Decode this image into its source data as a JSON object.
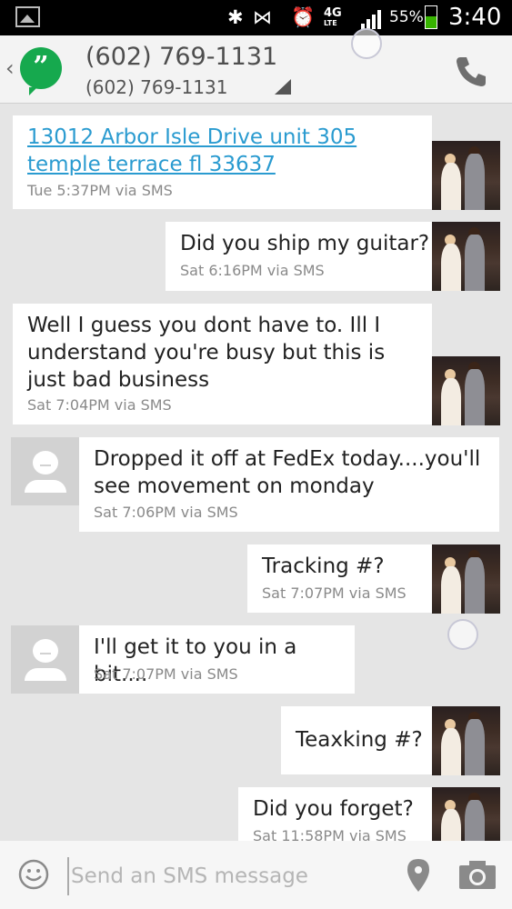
{
  "status_bar": {
    "battery_percent_label": "55%",
    "battery_level": 0.55,
    "network_label": "4G",
    "network_sub": "LTE",
    "time": "3:40",
    "icons": [
      "image-icon",
      "bluetooth-icon",
      "mute-icon",
      "alarm-icon",
      "signal-icon",
      "battery-icon"
    ]
  },
  "header": {
    "title": "(602) 769-1131",
    "subtitle": "(602) 769-1131",
    "app_icon": "hangouts-icon",
    "call_icon": "phone-icon"
  },
  "messages": [
    {
      "side": "outgoing",
      "text": "13012 Arbor Isle Drive unit 305 temple terrace fl 33637",
      "is_link": true,
      "meta": "Tue 5:37PM via SMS"
    },
    {
      "side": "outgoing",
      "text": "Did you ship my guitar?",
      "meta": "Sat 6:16PM via SMS"
    },
    {
      "side": "outgoing",
      "text": "Well I guess you dont have to. Ill I understand you're busy but this is just bad business",
      "meta": "Sat 7:04PM via SMS"
    },
    {
      "side": "incoming",
      "text": "Dropped it off at FedEx today....you'll see movement on monday",
      "meta": "Sat 7:06PM via SMS"
    },
    {
      "side": "outgoing",
      "text": "Tracking #?",
      "meta": "Sat 7:07PM via SMS"
    },
    {
      "side": "incoming",
      "text": "I'll get it to you in a bit....",
      "meta": "Sat 7:07PM via SMS"
    },
    {
      "side": "outgoing",
      "text": "Teaxking #?",
      "meta": ""
    },
    {
      "side": "outgoing",
      "text": "Did you forget?",
      "meta": "Sat 11:58PM via SMS"
    }
  ],
  "compose": {
    "placeholder": "Send an SMS message",
    "emoji_icon": "smiley-icon",
    "location_icon": "location-pin-icon",
    "camera_icon": "camera-icon"
  },
  "colors": {
    "accent_green": "#16a94e",
    "link_blue": "#2a9bd0",
    "battery_green": "#37b400",
    "background": "#e5e5e5"
  }
}
